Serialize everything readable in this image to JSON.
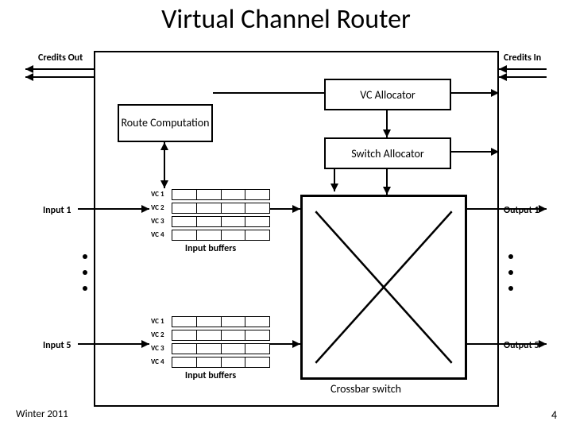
{
  "title": "Virtual Channel Router",
  "credits_out": "Credits Out",
  "credits_in": "Credits In",
  "vc_allocator": "VC Allocator",
  "switch_allocator": "Switch Allocator",
  "route_computation": "Route Computation",
  "crossbar": "Crossbar switch",
  "input_buffers": "Input buffers",
  "vc_labels": [
    "VC 1",
    "VC 2",
    "VC 3",
    "VC 4"
  ],
  "input1": "Input 1",
  "input5": "Input 5",
  "output1": "Output 1",
  "output5": "Output 5",
  "footer_left": "Winter 2011",
  "footer_right": "4",
  "chart_data": {
    "type": "diagram",
    "title": "Virtual Channel Router",
    "blocks": [
      {
        "name": "VC Allocator"
      },
      {
        "name": "Switch Allocator"
      },
      {
        "name": "Route Computation"
      },
      {
        "name": "Crossbar switch"
      },
      {
        "name": "Input buffers",
        "instances": 2,
        "rows": [
          "VC 1",
          "VC 2",
          "VC 3",
          "VC 4"
        ],
        "cells_per_row": 4
      }
    ],
    "ports": {
      "inputs": [
        "Input 1",
        "Input 5"
      ],
      "outputs": [
        "Output 1",
        "Output 5"
      ],
      "credits": [
        "Credits Out",
        "Credits In"
      ]
    },
    "connections": [
      "Credits Out <-> router",
      "Credits In <-> router",
      "Route Computation <-> Input buffers",
      "Route Computation -> VC Allocator",
      "VC Allocator -> Switch Allocator",
      "Switch Allocator -> Input buffers",
      "Switch Allocator -> Crossbar switch",
      "Input buffers -> Crossbar switch",
      "Input 1 -> Input buffers (top)",
      "Input 5 -> Input buffers (bottom)",
      "Crossbar switch -> Output 1",
      "Crossbar switch -> Output 5"
    ]
  }
}
